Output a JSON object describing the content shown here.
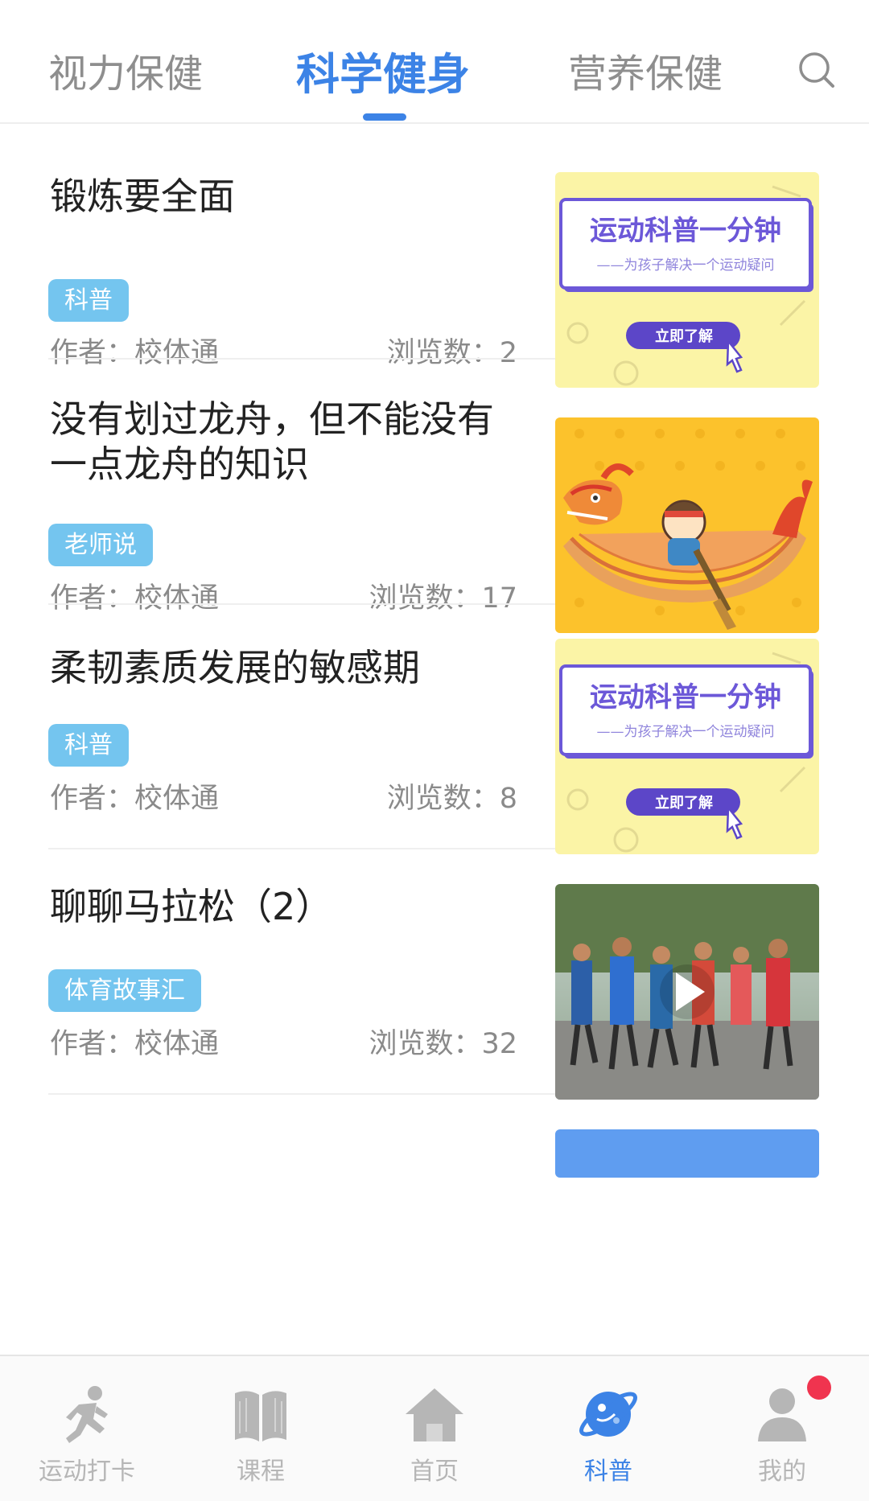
{
  "tabs": [
    {
      "label": "视力保健"
    },
    {
      "label": "科学健身"
    },
    {
      "label": "营养保健"
    }
  ],
  "articles": [
    {
      "title": "锻炼要全面",
      "tag": "科普",
      "author": "作者：校体通",
      "views": "浏览数：2",
      "thumb": {
        "headline": "运动科普一分钟",
        "subline": "——为孩子解决一个运动疑问",
        "button": "立即了解"
      }
    },
    {
      "title": " 没有划过龙舟，但不能没有一点龙舟的知识",
      "tag": "老师说",
      "author": "作者：校体通",
      "views": "浏览数：17"
    },
    {
      "title": "柔韧素质发展的敏感期",
      "tag": "科普",
      "author": "作者：校体通",
      "views": "浏览数：8",
      "thumb": {
        "headline": "运动科普一分钟",
        "subline": "——为孩子解决一个运动疑问",
        "button": "立即了解"
      }
    },
    {
      "title": "聊聊马拉松（2）",
      "tag": "体育故事汇",
      "author": "作者：校体通",
      "views": "浏览数：32"
    }
  ],
  "bottom_nav": [
    {
      "label": "运动打卡",
      "icon": "runner-icon"
    },
    {
      "label": "课程",
      "icon": "book-icon"
    },
    {
      "label": "首页",
      "icon": "home-icon"
    },
    {
      "label": "科普",
      "icon": "planet-icon"
    },
    {
      "label": "我的",
      "icon": "user-icon"
    }
  ],
  "colors": {
    "accent": "#3c83e6",
    "tag": "#74c5ef",
    "badge": "#f0344f",
    "inactive": "#b6b6b6"
  }
}
